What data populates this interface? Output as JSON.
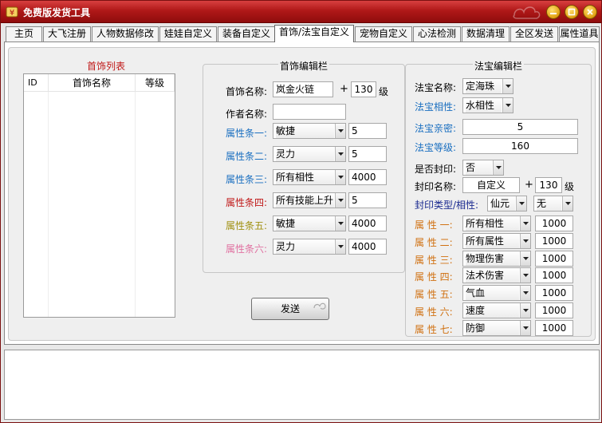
{
  "window": {
    "title": "免费版发货工具"
  },
  "tabs": [
    {
      "label": "主页"
    },
    {
      "label": "大飞注册"
    },
    {
      "label": "人物数据修改"
    },
    {
      "label": "娃娃自定义"
    },
    {
      "label": "装备自定义"
    },
    {
      "label": "首饰/法宝自定义"
    },
    {
      "label": "宠物自定义"
    },
    {
      "label": "心法检测"
    },
    {
      "label": "数据清理"
    },
    {
      "label": "全区发送"
    },
    {
      "label": "属性道具"
    }
  ],
  "active_tab": "首饰/法宝自定义",
  "jewelry_list": {
    "title": "首饰列表",
    "columns": [
      "ID",
      "首饰名称",
      "等级"
    ]
  },
  "jewelry_editor": {
    "title": "首饰编辑栏",
    "name_label": "首饰名称:",
    "name_value": "岚金火链",
    "level_value": "130",
    "level_unit": "级",
    "author_label": "作者名称:",
    "author_value": "",
    "attrs": [
      {
        "label": "属性条一:",
        "option": "敏捷",
        "value": "5",
        "color": "#1a6fc0"
      },
      {
        "label": "属性条二:",
        "option": "灵力",
        "value": "5",
        "color": "#1a6fc0"
      },
      {
        "label": "属性条三:",
        "option": "所有相性",
        "value": "4000",
        "color": "#1a6fc0"
      },
      {
        "label": "属性条四:",
        "option": "所有技能上升",
        "value": "5",
        "color": "#c01818"
      },
      {
        "label": "属性条五:",
        "option": "敏捷",
        "value": "4000",
        "color": "#a09010"
      },
      {
        "label": "属性条六:",
        "option": "灵力",
        "value": "4000",
        "color": "#e070a0"
      }
    ]
  },
  "send_button": "发送",
  "treasure_editor": {
    "title": "法宝编辑栏",
    "name_label": "法宝名称:",
    "name_option": "定海珠",
    "phase_label": "法宝相性:",
    "phase_option": "水相性",
    "intimacy_label": "法宝亲密:",
    "intimacy_value": "5",
    "level_label": "法宝等级:",
    "level_value": "160",
    "seal_label": "是否封印:",
    "seal_option": "否",
    "seal_name_label": "封印名称:",
    "seal_name_value": "自定义",
    "seal_level_value": "130",
    "seal_level_unit": "级",
    "seal_type_label": "封印类型/相性:",
    "seal_type_option": "仙元",
    "seal_phase_option": "无",
    "attrs": [
      {
        "label": "属 性 一:",
        "option": "所有相性",
        "value": "1000"
      },
      {
        "label": "属 性 二:",
        "option": "所有属性",
        "value": "1000"
      },
      {
        "label": "属 性 三:",
        "option": "物理伤害",
        "value": "1000"
      },
      {
        "label": "属 性 四:",
        "option": "法术伤害",
        "value": "1000"
      },
      {
        "label": "属 性 五:",
        "option": "气血",
        "value": "1000"
      },
      {
        "label": "属 性 六:",
        "option": "速度",
        "value": "1000"
      },
      {
        "label": "属 性 七:",
        "option": "防御",
        "value": "1000"
      }
    ],
    "colors": {
      "blue_label": "#1a6fc0",
      "orange_label": "#d07010",
      "navy_label": "#1a2a90"
    }
  }
}
